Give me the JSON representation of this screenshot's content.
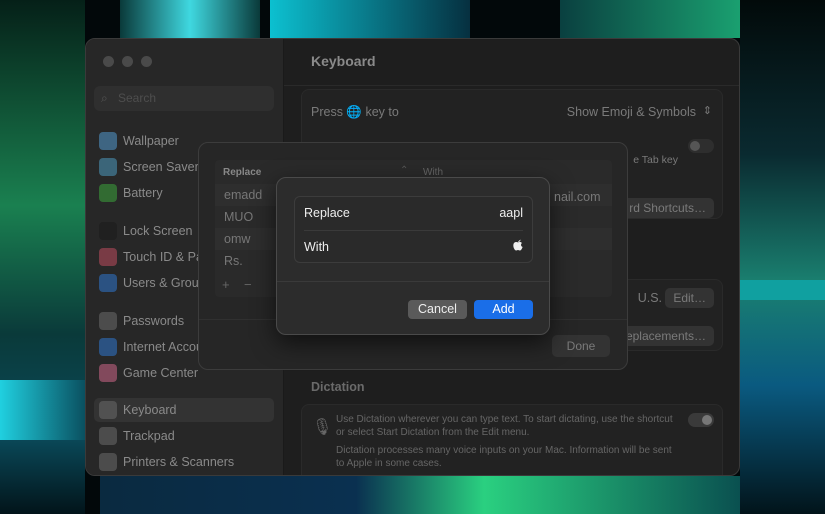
{
  "window": {
    "title": "Keyboard"
  },
  "sidebar": {
    "search_placeholder": "Search",
    "items": [
      {
        "label": "Wallpaper",
        "color": "#4f8fbf"
      },
      {
        "label": "Screen Saver",
        "color": "#4a8fb0"
      },
      {
        "label": "Battery",
        "color": "#3a9a3a"
      },
      {
        "label": "Lock Screen",
        "color": "#1c1c1c"
      },
      {
        "label": "Touch ID & Password",
        "color": "#b04a5a"
      },
      {
        "label": "Users & Groups",
        "color": "#2f6fc0"
      },
      {
        "label": "Passwords",
        "color": "#666"
      },
      {
        "label": "Internet Accounts",
        "color": "#2f6fc0"
      },
      {
        "label": "Game Center",
        "color": "#c06080"
      },
      {
        "label": "Keyboard",
        "color": "#666"
      },
      {
        "label": "Trackpad",
        "color": "#666"
      },
      {
        "label": "Printers & Scanners",
        "color": "#666"
      }
    ]
  },
  "main": {
    "press_key_label": "Press 🌐 key to",
    "press_key_value": "Show Emoji & Symbols",
    "tab_key_text": "e Tab key",
    "shortcuts_button": "rd Shortcuts…",
    "input_source": "U.S.",
    "edit_button": "Edit…",
    "replacements_button": "eplacements…",
    "dictation_heading": "Dictation",
    "dictation_text1": "Use Dictation wherever you can type text. To start dictating, use the shortcut or select Start Dictation from the Edit menu.",
    "dictation_text2": "Dictation processes many voice inputs on your Mac. Information will be sent to Apple in some cases."
  },
  "replacements_sheet": {
    "col_replace": "Replace",
    "col_with": "With",
    "rows": [
      "emadd",
      "MUO",
      "omw",
      "Rs."
    ],
    "visible_with": "nail.com",
    "add": "+",
    "remove": "−",
    "done": "Done"
  },
  "add_dialog": {
    "replace_label": "Replace",
    "replace_value": "aapl",
    "with_label": "With",
    "with_value": "",
    "cancel": "Cancel",
    "add": "Add",
    "accent": "#1a6ee8"
  }
}
